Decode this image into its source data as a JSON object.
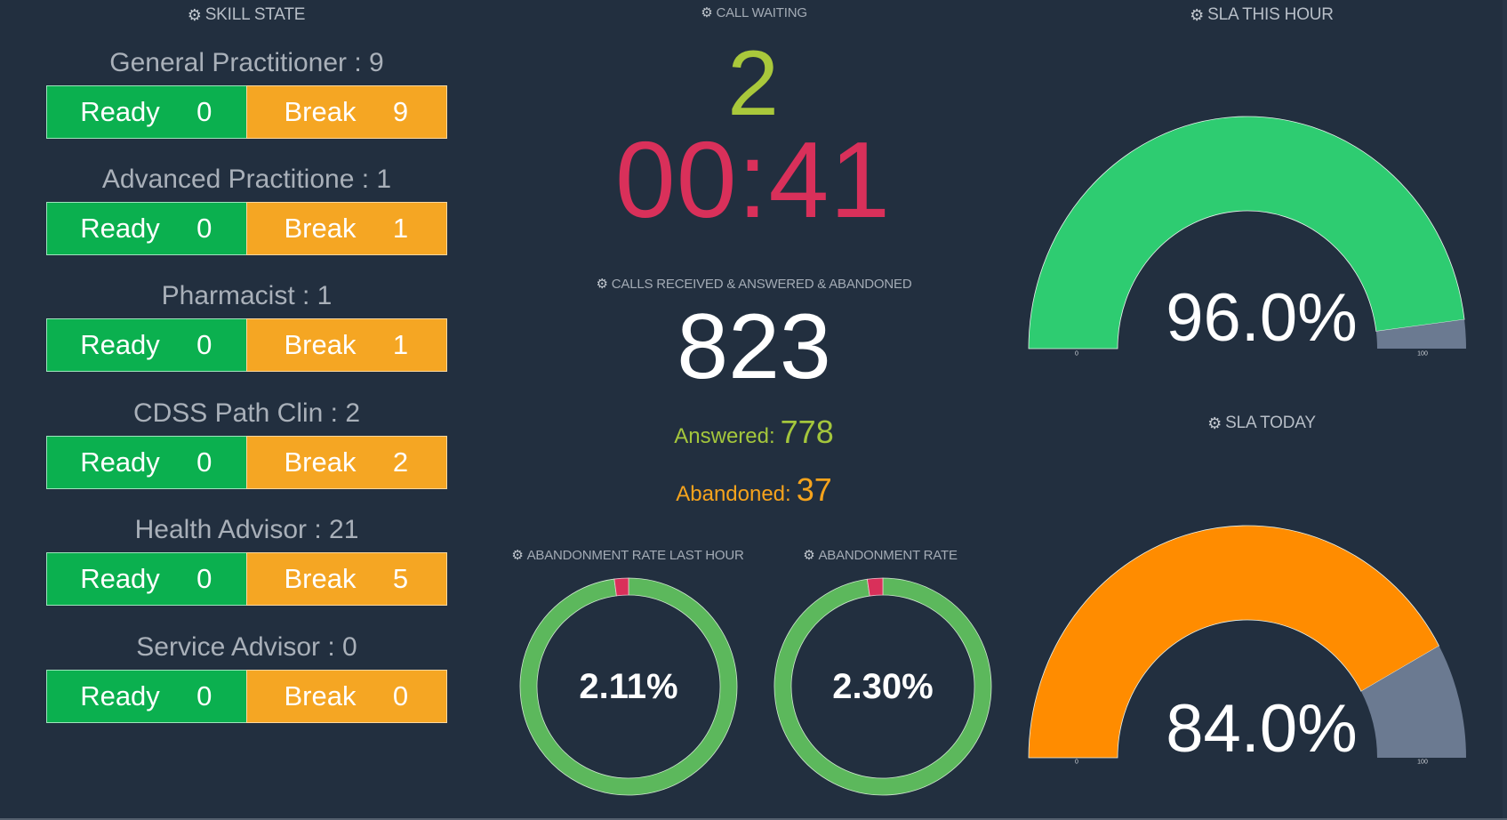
{
  "skill_state": {
    "title": "SKILL STATE",
    "icon": "gear-icon",
    "ready_label": "Ready",
    "break_label": "Break",
    "skills": [
      {
        "name": "General Practitioner",
        "total": 9,
        "label": "General Practitioner : 9",
        "ready": 0,
        "break": 9
      },
      {
        "name": "Advanced Practitione",
        "total": 1,
        "label": "Advanced Practitione : 1",
        "ready": 0,
        "break": 1
      },
      {
        "name": "Pharmacist",
        "total": 1,
        "label": "Pharmacist : 1",
        "ready": 0,
        "break": 1
      },
      {
        "name": "CDSS Path Clin",
        "total": 2,
        "label": "CDSS Path Clin : 2",
        "ready": 0,
        "break": 2
      },
      {
        "name": "Health Advisor",
        "total": 21,
        "label": "Health Advisor : 21",
        "ready": 0,
        "break": 5
      },
      {
        "name": "Service Advisor",
        "total": 0,
        "label": "Service Advisor : 0",
        "ready": 0,
        "break": 0
      }
    ]
  },
  "call_waiting": {
    "title": "CALL WAITING",
    "icon": "gear-icon",
    "count": "2",
    "longest_wait": "00:41"
  },
  "calls": {
    "title": "CALLS RECEIVED & ANSWERED & ABANDONED",
    "icon": "gear-icon",
    "received": "823",
    "answered_label": "Answered:",
    "answered": "778",
    "abandoned_label": "Abandoned:",
    "abandoned": "37"
  },
  "abandonment_last_hour": {
    "title": "ABANDONMENT RATE LAST HOUR",
    "icon": "gear-icon",
    "value_text": "2.11%",
    "percent": 2.11
  },
  "abandonment_rate": {
    "title": "ABANDONMENT RATE",
    "icon": "gear-icon",
    "value_text": "2.30%",
    "percent": 2.3
  },
  "sla_this_hour": {
    "title": "SLA THIS HOUR",
    "icon": "gear-icon",
    "value_text": "96.0%",
    "percent": 96.0,
    "min_label": "0",
    "max_label": "100"
  },
  "sla_today": {
    "title": "SLA TODAY",
    "icon": "gear-icon",
    "value_text": "84.0%",
    "percent": 84.0,
    "min_label": "0",
    "max_label": "100"
  },
  "colors": {
    "background": "#222f3f",
    "ready": "#0bb04f",
    "break": "#f5a623",
    "donut_ok": "#5cb85c",
    "donut_abandon": "#d9305a",
    "gauge_good": "#2ecc71",
    "gauge_warn": "#ff8c00",
    "gauge_remainder": "#6b7a91",
    "waiting_count": "#a9c83b",
    "waiting_time": "#d9305a"
  }
}
